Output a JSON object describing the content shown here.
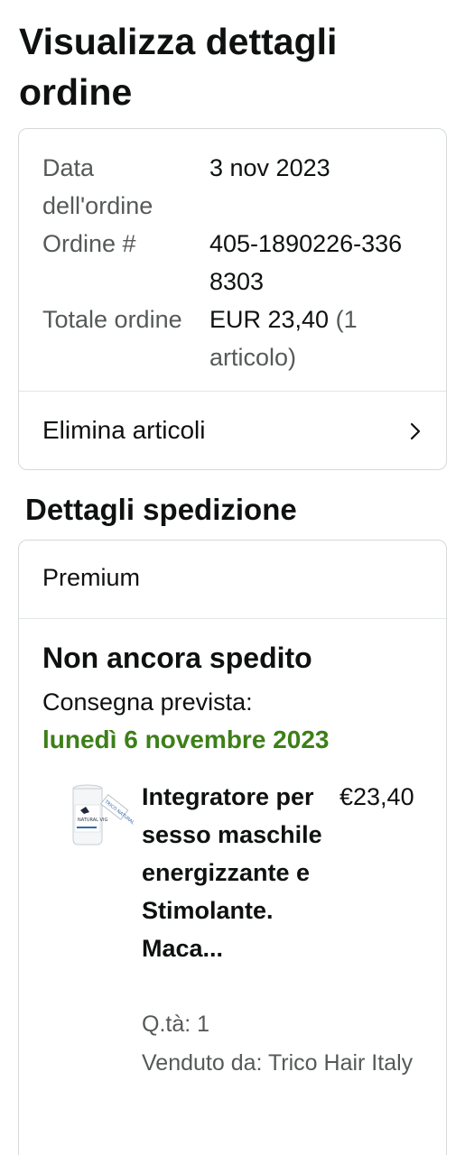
{
  "page": {
    "title": "Visualizza dettagli ordine"
  },
  "order_summary": {
    "rows": [
      {
        "key": "Data dell'ordine",
        "value": "3 nov 2023"
      },
      {
        "key": "Ordine #",
        "value": "405-1890226-3368303"
      },
      {
        "key": "Totale ordine",
        "value": "EUR 23,40",
        "value_suffix": "(1 articolo)"
      }
    ],
    "action_label": "Elimina articoli",
    "action_icon": "chevron-right-icon"
  },
  "shipment": {
    "section_title": "Dettagli spedizione",
    "type": "Premium",
    "status": "Non ancora spedito",
    "delivery_label": "Consegna prevista:",
    "delivery_date": "lunedì 6 novembre 2023",
    "delivery_color": "#3d7f18",
    "item": {
      "title": "Integratore per sesso maschile energizzante e Stimolante. Maca...",
      "price": "€23,40",
      "quantity": "Q.tà: 1",
      "seller": "Venduto da: Trico Hair Italy",
      "image_label": "NATURAL VIG",
      "image_tag": "TRICO NATURAL"
    }
  }
}
